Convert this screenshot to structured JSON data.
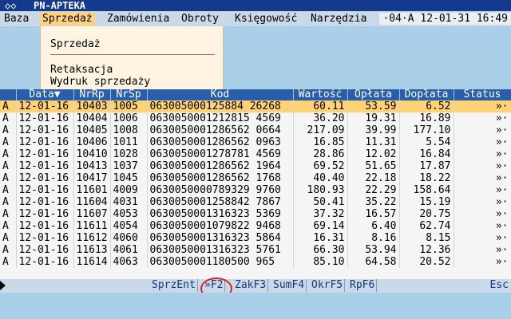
{
  "title": {
    "icon": "◇◇",
    "text": "PN-APTEKA"
  },
  "menu": {
    "items": [
      {
        "label": "Baza"
      },
      {
        "label": "Sprzedaż"
      },
      {
        "label": "Zamówienia"
      },
      {
        "label": "Obroty"
      },
      {
        "label": "Księgowość"
      },
      {
        "label": "Narzędzia"
      }
    ],
    "clock": "·04·A 12-01-31 16:49"
  },
  "dropdown": {
    "items": [
      {
        "label": "Sprzedaż"
      },
      {
        "label": "Retaksacja"
      },
      {
        "label": "Wydruk sprzedaży"
      }
    ]
  },
  "table": {
    "columns": [
      "",
      "Data▼",
      "NrRp",
      "NrSp",
      "Kod",
      "Wartość",
      "Opłata",
      "Dopłata",
      "Status"
    ],
    "rows": [
      [
        "A",
        "12-01-16",
        "10403",
        "1005",
        "063005000125884 26268",
        "60.11",
        "53.59",
        "6.52",
        "»·"
      ],
      [
        "A",
        "12-01-16",
        "10404",
        "1006",
        "0630050001212815 4569",
        "36.20",
        "19.31",
        "16.89",
        "»·"
      ],
      [
        "A",
        "12-01-16",
        "10405",
        "1008",
        "0630050001286562 0664",
        "217.09",
        "39.99",
        "177.10",
        "»·"
      ],
      [
        "A",
        "12-01-16",
        "10406",
        "1011",
        "0630050001286562 0963",
        "16.85",
        "11.31",
        "5.54",
        "»·"
      ],
      [
        "A",
        "12-01-16",
        "10410",
        "1028",
        "0630050001278781 4569",
        "28.86",
        "12.02",
        "16.84",
        "»·"
      ],
      [
        "A",
        "12-01-16",
        "10413",
        "1037",
        "0630050001286562 1964",
        "69.52",
        "51.65",
        "17.87",
        "»·"
      ],
      [
        "A",
        "12-01-16",
        "10417",
        "1045",
        "0630050001286562 1768",
        "40.40",
        "22.18",
        "18.22",
        "»·"
      ],
      [
        "A",
        "12-01-16",
        "11601",
        "4009",
        "0630050000789329 9760",
        "180.93",
        "22.29",
        "158.64",
        "»·"
      ],
      [
        "A",
        "12-01-16",
        "11604",
        "4031",
        "0630050001258842 7867",
        "50.41",
        "35.22",
        "15.19",
        "»·"
      ],
      [
        "A",
        "12-01-16",
        "11607",
        "4053",
        "0630050001316323 5369",
        "37.32",
        "16.57",
        "20.75",
        "»·"
      ],
      [
        "A",
        "12-01-16",
        "11611",
        "4054",
        "0630050001079822 9468",
        "69.14",
        "6.40",
        "62.74",
        "»·"
      ],
      [
        "A",
        "12-01-16",
        "11612",
        "4060",
        "0630050001316323 5864",
        "16.31",
        "8.16",
        "8.15",
        "»·"
      ],
      [
        "A",
        "12-01-16",
        "11613",
        "4061",
        "0630050001316323 5761",
        "66.30",
        "53.94",
        "12.36",
        "»·"
      ],
      [
        "A",
        "12-01-16",
        "11614",
        "4063",
        "0630050001180500 965",
        "85.10",
        "64.58",
        "20.52",
        "»·"
      ]
    ]
  },
  "statusbar": {
    "keys": [
      {
        "label": "SprzEnt"
      },
      {
        "label": "»F2"
      },
      {
        "label": "ZakF3"
      },
      {
        "label": "SumF4"
      },
      {
        "label": "OkrF5"
      },
      {
        "label": "RpF6"
      }
    ],
    "esc": "Esc"
  }
}
